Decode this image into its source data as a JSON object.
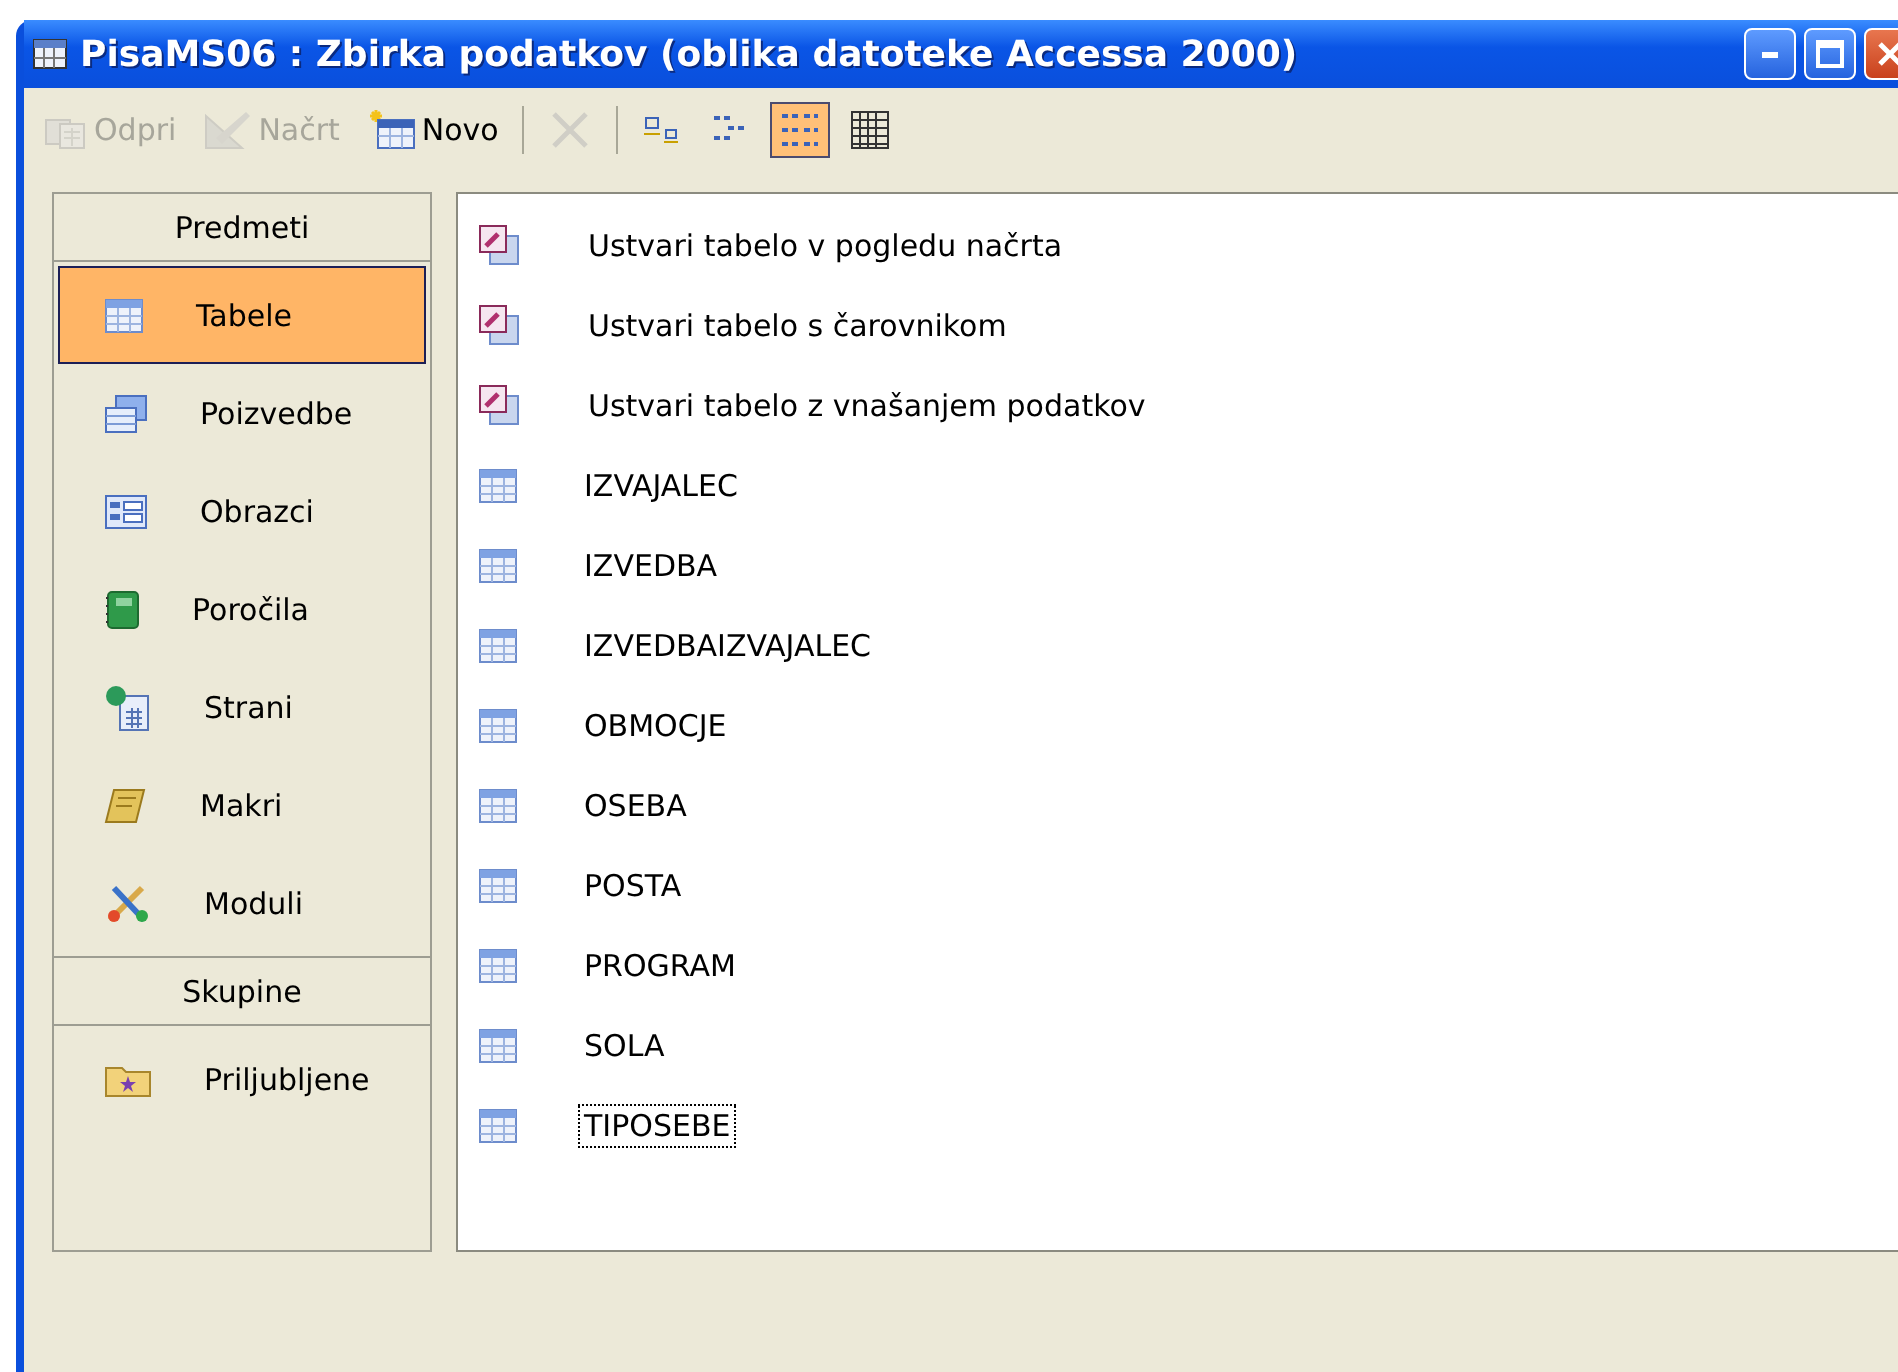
{
  "window": {
    "title": "PisaMS06 : Zbirka podatkov (oblika datoteke Accessa 2000)"
  },
  "toolbar": [
    {
      "kind": "open",
      "label": "Odpri",
      "disabled": true,
      "selected": false
    },
    {
      "kind": "design",
      "label": "Načrt",
      "disabled": true,
      "selected": false
    },
    {
      "kind": "new",
      "label": "Novo",
      "disabled": false,
      "selected": false
    },
    {
      "kind": "separator"
    },
    {
      "kind": "delete",
      "disabled": true,
      "selected": false
    },
    {
      "kind": "separator"
    },
    {
      "kind": "large",
      "disabled": false,
      "selected": false
    },
    {
      "kind": "small",
      "disabled": false,
      "selected": false
    },
    {
      "kind": "list",
      "disabled": false,
      "selected": true
    },
    {
      "kind": "details",
      "disabled": false,
      "selected": false
    }
  ],
  "sidebar": {
    "groups": [
      {
        "title": "Predmeti",
        "items": [
          {
            "label": "Tabele",
            "kind": "table",
            "selected": true
          },
          {
            "label": "Poizvedbe",
            "kind": "query",
            "selected": false
          },
          {
            "label": "Obrazci",
            "kind": "form",
            "selected": false
          },
          {
            "label": "Poročila",
            "kind": "report",
            "selected": false
          },
          {
            "label": "Strani",
            "kind": "page",
            "selected": false
          },
          {
            "label": "Makri",
            "kind": "macro",
            "selected": false
          },
          {
            "label": "Moduli",
            "kind": "module",
            "selected": false
          }
        ]
      },
      {
        "title": "Skupine",
        "items": [
          {
            "label": "Priljubljene",
            "kind": "favorites",
            "selected": false
          }
        ]
      }
    ]
  },
  "objects": [
    {
      "kind": "shortcut",
      "label": "Ustvari tabelo v pogledu načrta",
      "focused": false
    },
    {
      "kind": "shortcut",
      "label": "Ustvari tabelo s čarovnikom",
      "focused": false
    },
    {
      "kind": "shortcut",
      "label": "Ustvari tabelo z vnašanjem podatkov",
      "focused": false
    },
    {
      "kind": "table",
      "label": "IZVAJALEC",
      "focused": false
    },
    {
      "kind": "table",
      "label": "IZVEDBA",
      "focused": false
    },
    {
      "kind": "table",
      "label": "IZVEDBAIZVAJALEC",
      "focused": false
    },
    {
      "kind": "table",
      "label": "OBMOCJE",
      "focused": false
    },
    {
      "kind": "table",
      "label": "OSEBA",
      "focused": false
    },
    {
      "kind": "table",
      "label": "POSTA",
      "focused": false
    },
    {
      "kind": "table",
      "label": "PROGRAM",
      "focused": false
    },
    {
      "kind": "table",
      "label": "SOLA",
      "focused": false
    },
    {
      "kind": "table",
      "label": "TIPOSEBE",
      "focused": true
    }
  ]
}
